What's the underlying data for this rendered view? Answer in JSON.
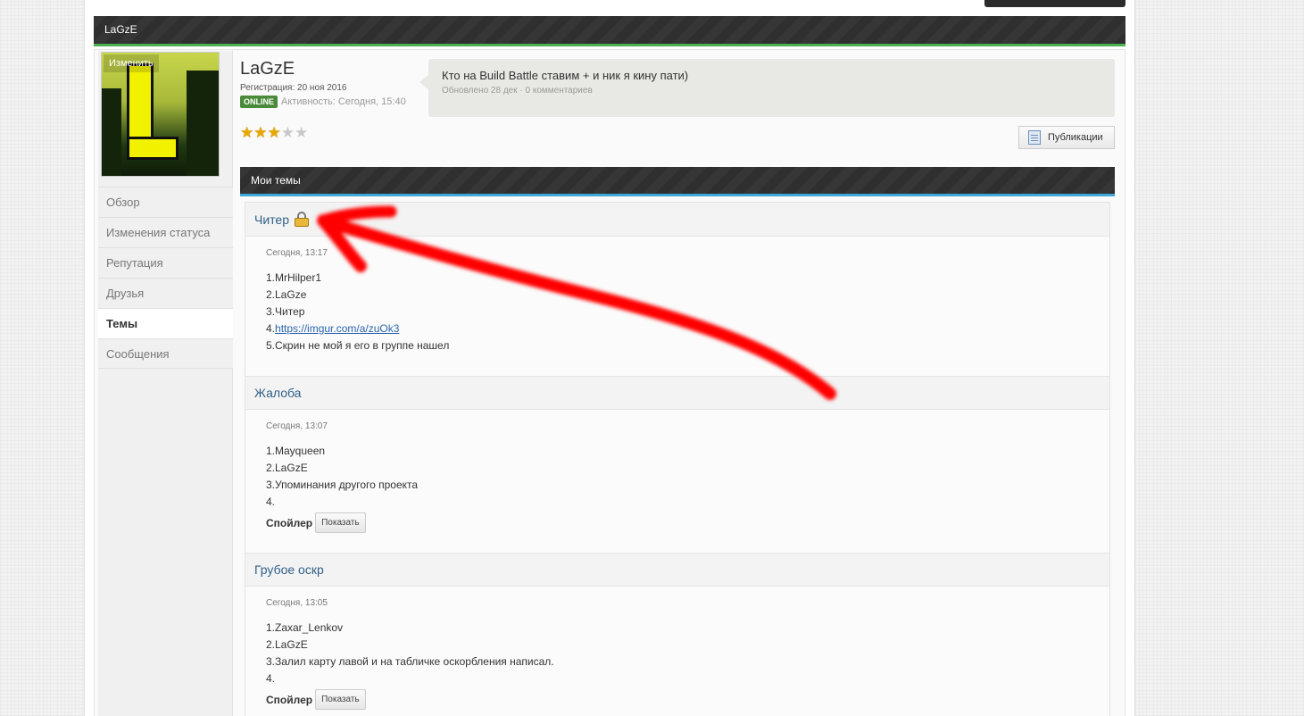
{
  "header": {
    "title": "LaGzE"
  },
  "avatar": {
    "edit_label": "Изменить"
  },
  "sidebar": {
    "items": [
      {
        "label": "Обзор"
      },
      {
        "label": "Изменения статуса"
      },
      {
        "label": "Репутация"
      },
      {
        "label": "Друзья"
      },
      {
        "label": "Темы",
        "active": true
      },
      {
        "label": "Сообщения"
      }
    ]
  },
  "profile": {
    "username": "LaGzE",
    "registration": "Регистрация: 20 ноя 2016",
    "online_badge": "ONLINE",
    "activity": "Активность: Сегодня, 15:40",
    "rating_stars": 3,
    "rating_max": 5
  },
  "status": {
    "text": "Кто на Build Battle ставим + и ник я кину пати)",
    "meta": "Обновлено 28 дек · 0 комментариев"
  },
  "publications_button": {
    "label": "Публикации",
    "icon": "document-icon"
  },
  "section": {
    "title": "Мои темы"
  },
  "topics": [
    {
      "title": "Читер",
      "locked": true,
      "date": "Сегодня, 13:17",
      "lines": [
        "1.MrHilper1",
        "2.LaGze",
        "3.Читер"
      ],
      "link_prefix": "4.",
      "link": "https://imgur.com/a/zuOk3",
      "last_line": "5.Скрин не мой я его  в группе нашел"
    },
    {
      "title": "Жалоба",
      "date": "Сегодня, 13:07",
      "lines": [
        "1.Mayqueen",
        "2.LaGzE",
        "3.Упоминания другого проекта",
        "4."
      ],
      "spoiler_label": "Спойлер",
      "spoiler_button": "Показать"
    },
    {
      "title": "Грубое оскр",
      "date": "Сегодня, 13:05",
      "lines": [
        "1.Zaxar_Lenkov",
        "2.LaGzE",
        "3.Залил карту лавой и на табличке оскорбления написал.",
        "4."
      ],
      "spoiler_label": "Спойлер",
      "spoiler_button": "Показать"
    }
  ],
  "colors": {
    "header_accent": "#4caf50",
    "section_accent": "#3fa8d6",
    "online": "#4a8b3b",
    "topic_title": "#2f5f88",
    "annotation_arrow": "#ff0000"
  }
}
